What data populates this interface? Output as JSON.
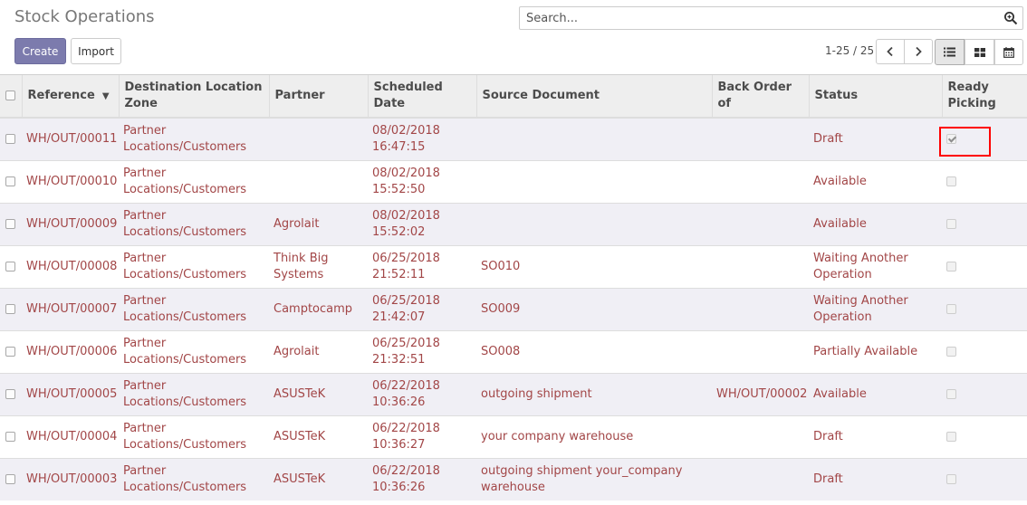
{
  "page": {
    "title": "Stock Operations",
    "search_placeholder": "Search..."
  },
  "toolbar": {
    "create_label": "Create",
    "import_label": "Import"
  },
  "pager": {
    "value": "1-25 / 25"
  },
  "icons": {
    "search": "search-icon",
    "prev": "chevron-left-icon",
    "next": "chevron-right-icon",
    "list": "list-view-icon",
    "kanban": "kanban-view-icon",
    "calendar": "calendar-view-icon",
    "sort": "caret-down-icon"
  },
  "colors": {
    "primary": "#7c7bad",
    "link": "#a24647",
    "row_alt": "#f0eff5",
    "highlight": "#ff0000"
  },
  "table": {
    "columns": [
      "Reference",
      "Destination Location Zone",
      "Partner",
      "Scheduled Date",
      "Source Document",
      "Back Order of",
      "Status",
      "Ready Picking"
    ],
    "rows": [
      {
        "reference": "WH/OUT/00011",
        "destination": "Partner Locations/Customers",
        "partner": "",
        "scheduled": "08/02/2018 16:47:15",
        "source": "",
        "backorder": "",
        "status": "Draft",
        "ready": true
      },
      {
        "reference": "WH/OUT/00010",
        "destination": "Partner Locations/Customers",
        "partner": "",
        "scheduled": "08/02/2018 15:52:50",
        "source": "",
        "backorder": "",
        "status": "Available",
        "ready": false
      },
      {
        "reference": "WH/OUT/00009",
        "destination": "Partner Locations/Customers",
        "partner": "Agrolait",
        "scheduled": "08/02/2018 15:52:02",
        "source": "",
        "backorder": "",
        "status": "Available",
        "ready": false
      },
      {
        "reference": "WH/OUT/00008",
        "destination": "Partner Locations/Customers",
        "partner": "Think Big Systems",
        "scheduled": "06/25/2018 21:52:11",
        "source": "SO010",
        "backorder": "",
        "status": "Waiting Another Operation",
        "ready": false
      },
      {
        "reference": "WH/OUT/00007",
        "destination": "Partner Locations/Customers",
        "partner": "Camptocamp",
        "scheduled": "06/25/2018 21:42:07",
        "source": "SO009",
        "backorder": "",
        "status": "Waiting Another Operation",
        "ready": false
      },
      {
        "reference": "WH/OUT/00006",
        "destination": "Partner Locations/Customers",
        "partner": "Agrolait",
        "scheduled": "06/25/2018 21:32:51",
        "source": "SO008",
        "backorder": "",
        "status": "Partially Available",
        "ready": false
      },
      {
        "reference": "WH/OUT/00005",
        "destination": "Partner Locations/Customers",
        "partner": "ASUSTeK",
        "scheduled": "06/22/2018 10:36:26",
        "source": "outgoing shipment",
        "backorder": "WH/OUT/00002",
        "status": "Available",
        "ready": false
      },
      {
        "reference": "WH/OUT/00004",
        "destination": "Partner Locations/Customers",
        "partner": "ASUSTeK",
        "scheduled": "06/22/2018 10:36:27",
        "source": "your company warehouse",
        "backorder": "",
        "status": "Draft",
        "ready": false
      },
      {
        "reference": "WH/OUT/00003",
        "destination": "Partner Locations/Customers",
        "partner": "ASUSTeK",
        "scheduled": "06/22/2018 10:36:26",
        "source": "outgoing shipment your_company warehouse",
        "backorder": "",
        "status": "Draft",
        "ready": false
      }
    ]
  }
}
